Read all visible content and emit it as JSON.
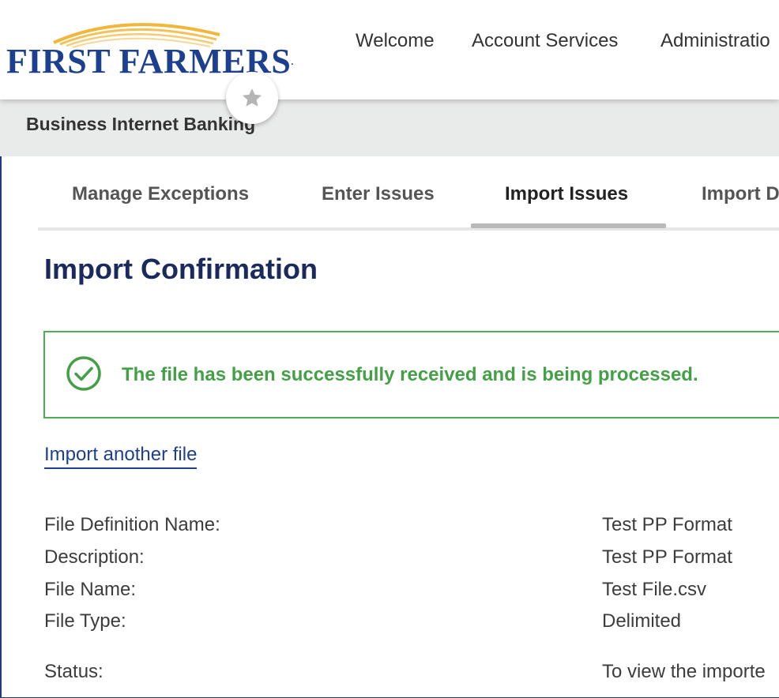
{
  "brand": {
    "name_first": "FIRST",
    "name_second": "FARMERS",
    "trademark": ".",
    "logo_colors": {
      "navy": "#1d3f8f",
      "gold": "#f1b73a"
    }
  },
  "topnav": {
    "items": [
      "Welcome",
      "Account Services",
      "Administratio"
    ]
  },
  "favorite": {
    "icon": "star-icon"
  },
  "subheader": {
    "title": "Business Internet Banking"
  },
  "tabs": {
    "items": [
      "Manage Exceptions",
      "Enter Issues",
      "Import Issues",
      "Import D"
    ],
    "active_index": 2
  },
  "page": {
    "title": "Import Confirmation"
  },
  "alert": {
    "icon": "check-circle-icon",
    "message": "The file has been successfully received and is being processed.",
    "color": "#43a047"
  },
  "actions": {
    "import_another": "Import another file"
  },
  "details": [
    {
      "label": "File Definition Name:",
      "value": "Test PP Format"
    },
    {
      "label": "Description:",
      "value": "Test PP Format"
    },
    {
      "label": "File Name:",
      "value": "Test File.csv"
    },
    {
      "label": "File Type:",
      "value": "Delimited"
    },
    {
      "label": "Status:",
      "value": "To view the importe"
    }
  ]
}
